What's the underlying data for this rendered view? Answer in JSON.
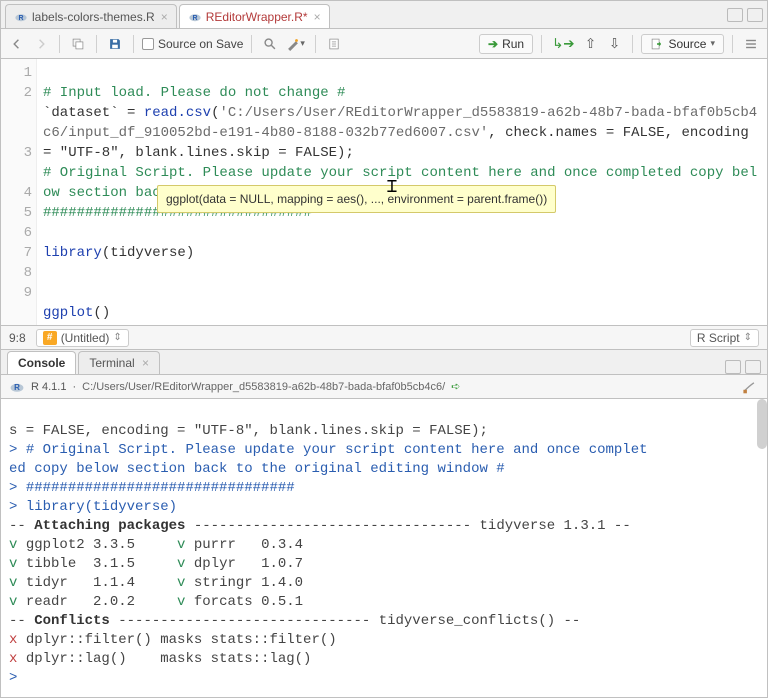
{
  "tabs": [
    {
      "label": "labels-colors-themes.R",
      "modified": false,
      "active": false
    },
    {
      "label": "REditorWrapper.R*",
      "modified": true,
      "active": true
    }
  ],
  "toolbar": {
    "source_on_save": "Source on Save",
    "run": "Run",
    "source": "Source"
  },
  "gutter": [
    "1",
    "2",
    "",
    "",
    "3",
    "",
    "4",
    "5",
    "6",
    "7",
    "8",
    "9"
  ],
  "code": {
    "l1": "# Input load. Please do not change #",
    "l2_ident": "`dataset`",
    "l2_eq": " = ",
    "l2_fn": "read.csv",
    "l2_open": "(",
    "l2_str": "'C:/Users/User/REditorWrapper_d5583819-a62b-48b7-bada-bfaf0b5cb4c6/input_df_910052bd-e191-4b80-8188-032b77ed6007.csv'",
    "l2_tail": ", check.names = FALSE, encoding = \"UTF-8\", blank.lines.skip = FALSE);",
    "l3": "# Original Script. Please update your script content here and once completed copy below section back to the original editing window #",
    "l4": "################################",
    "l6_fn": "library",
    "l6_arg": "(tidyverse)",
    "l9_fn": "ggplot",
    "l9_arg": "()"
  },
  "tooltip": "ggplot(data = NULL, mapping = aes(), ..., environment = parent.frame())",
  "status": {
    "pos": "9:8",
    "section": "(Untitled)",
    "lang": "R Script"
  },
  "console": {
    "tabs": [
      {
        "label": "Console",
        "active": true
      },
      {
        "label": "Terminal",
        "active": false
      }
    ],
    "version": "R 4.1.1",
    "path": "C:/Users/User/REditorWrapper_d5583819-a62b-48b7-bada-bfaf0b5cb4c6/",
    "out": {
      "line1": "s = FALSE, encoding = \"UTF-8\", blank.lines.skip = FALSE);",
      "line2": "# Original Script. Please update your script content here and once complet",
      "line3": "ed copy below section back to the original editing window #",
      "line4": "################################",
      "line5": "library(tidyverse)",
      "att_hdr": "Attaching packages",
      "att_tail": " tidyverse 1.3.1 --",
      "pk_ggplot": "ggplot2 3.3.5",
      "pk_purrr": "purrr   0.3.4",
      "pk_tibble": "tibble  3.1.5",
      "pk_dplyr": "dplyr   1.0.7",
      "pk_tidyr": "tidyr   1.1.4",
      "pk_stringr": "stringr 1.4.0",
      "pk_readr": "readr   2.0.2",
      "pk_forcats": "forcats 0.5.1",
      "conf_hdr": "Conflicts",
      "conf_tail": " tidyverse_conflicts() --",
      "conf1": "dplyr::filter() masks stats::filter()",
      "conf2": "dplyr::lag()    masks stats::lag()",
      "prompt": "> "
    }
  }
}
